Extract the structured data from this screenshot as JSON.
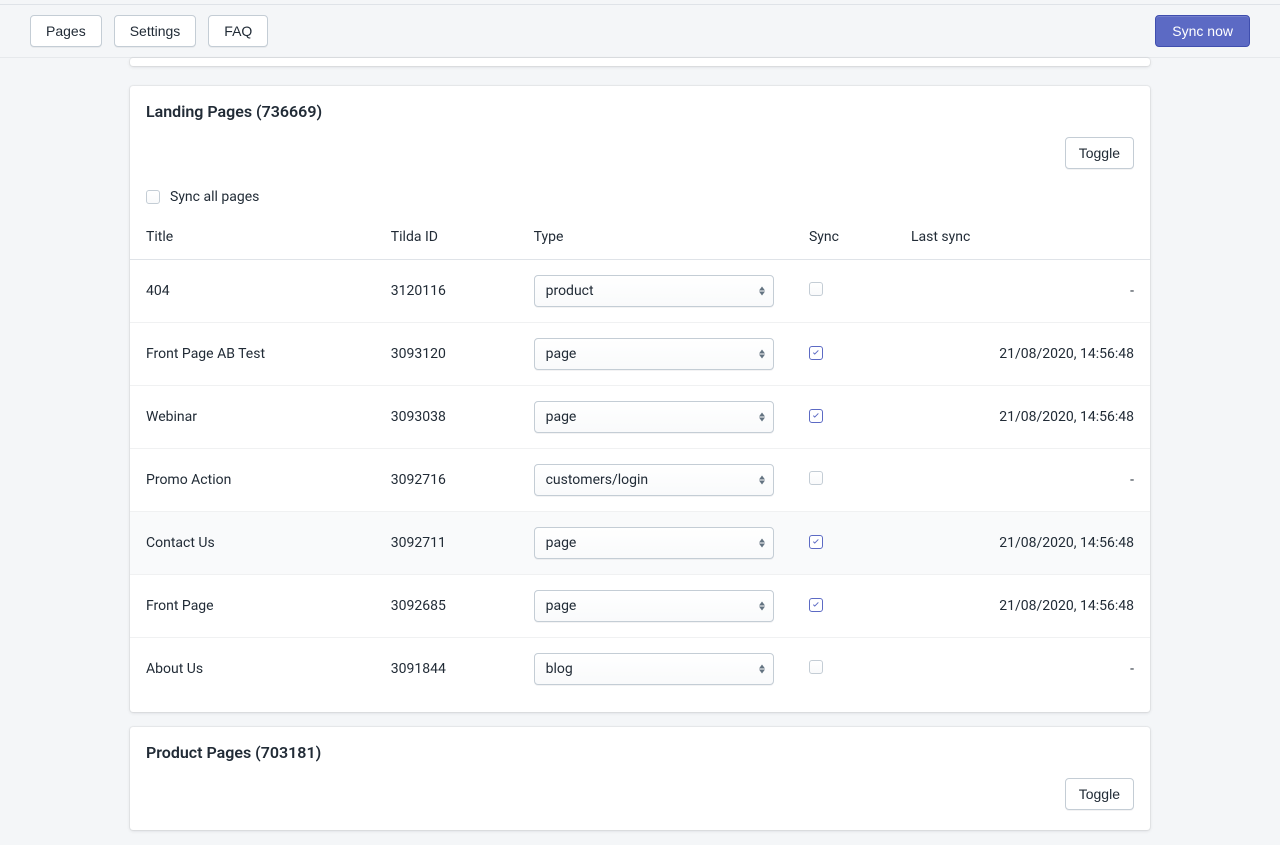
{
  "topbar": {
    "tabs": [
      {
        "label": "Pages"
      },
      {
        "label": "Settings"
      },
      {
        "label": "FAQ"
      }
    ],
    "syncNow": "Sync now"
  },
  "landingCard": {
    "title": "Landing Pages (736669)",
    "toggle": "Toggle",
    "syncAllLabel": "Sync all pages",
    "columns": {
      "title": "Title",
      "tildaId": "Tilda ID",
      "type": "Type",
      "sync": "Sync",
      "lastSync": "Last sync"
    },
    "rows": [
      {
        "title": "404",
        "tildaId": "3120116",
        "type": "product",
        "checked": false,
        "lastSync": "-",
        "highlighted": false
      },
      {
        "title": "Front Page AB Test",
        "tildaId": "3093120",
        "type": "page",
        "checked": true,
        "lastSync": "21/08/2020, 14:56:48",
        "highlighted": false
      },
      {
        "title": "Webinar",
        "tildaId": "3093038",
        "type": "page",
        "checked": true,
        "lastSync": "21/08/2020, 14:56:48",
        "highlighted": false
      },
      {
        "title": "Promo Action",
        "tildaId": "3092716",
        "type": "customers/login",
        "checked": false,
        "lastSync": "-",
        "highlighted": false
      },
      {
        "title": "Contact Us",
        "tildaId": "3092711",
        "type": "page",
        "checked": true,
        "lastSync": "21/08/2020, 14:56:48",
        "highlighted": true
      },
      {
        "title": "Front Page",
        "tildaId": "3092685",
        "type": "page",
        "checked": true,
        "lastSync": "21/08/2020, 14:56:48",
        "highlighted": false
      },
      {
        "title": "About Us",
        "tildaId": "3091844",
        "type": "blog",
        "checked": false,
        "lastSync": "-",
        "highlighted": false
      }
    ]
  },
  "productCard": {
    "title": "Product Pages (703181)",
    "toggle": "Toggle"
  }
}
